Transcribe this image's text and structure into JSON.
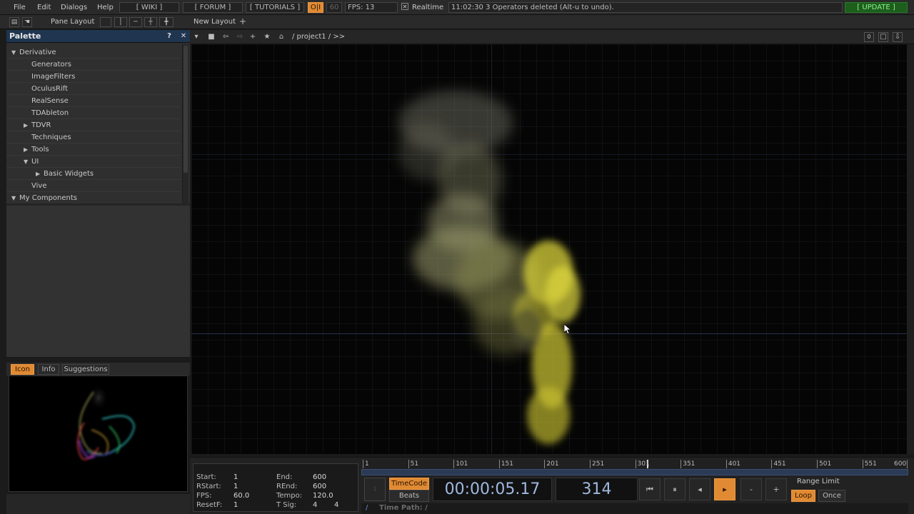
{
  "menu": {
    "items": [
      "File",
      "Edit",
      "Dialogs",
      "Help"
    ],
    "wiki": "[ WIKI ]",
    "forum": "[ FORUM ]",
    "tutorials": "[ TUTORIALS ]",
    "oi": "O|I",
    "fps_target": "60",
    "fps": "FPS:  13",
    "realtime": "Realtime",
    "status": "11:02:30 3 Operators deleted (Alt-u to undo).",
    "update": "[ UPDATE ]"
  },
  "layoutbar": {
    "pane_layout": "Pane Layout",
    "new_layout": "New Layout",
    "add": "+"
  },
  "palette": {
    "title": "Palette",
    "help": "?",
    "close": "✕",
    "items": [
      {
        "label": "Derivative",
        "indent": 0,
        "arrow": "down"
      },
      {
        "label": "Generators",
        "indent": 2,
        "arrow": ""
      },
      {
        "label": "ImageFilters",
        "indent": 2,
        "arrow": ""
      },
      {
        "label": "OculusRift",
        "indent": 2,
        "arrow": ""
      },
      {
        "label": "RealSense",
        "indent": 2,
        "arrow": ""
      },
      {
        "label": "TDAbleton",
        "indent": 2,
        "arrow": ""
      },
      {
        "label": "TDVR",
        "indent": 1,
        "arrow": "right"
      },
      {
        "label": "Techniques",
        "indent": 2,
        "arrow": ""
      },
      {
        "label": "Tools",
        "indent": 1,
        "arrow": "right"
      },
      {
        "label": "UI",
        "indent": 1,
        "arrow": "down"
      },
      {
        "label": "Basic Widgets",
        "indent": 3,
        "arrow": "right"
      },
      {
        "label": "Vive",
        "indent": 2,
        "arrow": ""
      },
      {
        "label": "My Components",
        "indent": 0,
        "arrow": "down"
      }
    ]
  },
  "viewer": {
    "tabs": [
      "Icon",
      "Info",
      "Suggestions"
    ],
    "active_tab": "Icon"
  },
  "network": {
    "path": "/ project1 / >>"
  },
  "time_settings": {
    "start_label": "Start:",
    "start": "1",
    "end_label": "End:",
    "end": "600",
    "rstart_label": "RStart:",
    "rstart": "1",
    "rend_label": "REnd:",
    "rend": "600",
    "fps_label": "FPS:",
    "fps": "60.0",
    "tempo_label": "Tempo:",
    "tempo": "120.0",
    "resetf_label": "ResetF:",
    "resetf": "1",
    "tsig_label": "T Sig:",
    "tsig_a": "4",
    "tsig_b": "4"
  },
  "ruler": {
    "ticks": [
      "1",
      "51",
      "101",
      "151",
      "201",
      "251",
      "301",
      "351",
      "401",
      "451",
      "501",
      "551",
      "600"
    ],
    "start": 1,
    "end": 600,
    "current_frame": 314
  },
  "transport": {
    "timecode_label": "TimeCode",
    "beats_label": "Beats",
    "timecode": "00:00:05.17",
    "frame": "314",
    "range_limit": "Range Limit",
    "loop": "Loop",
    "once": "Once",
    "minus": "-",
    "plus": "+"
  },
  "time_path": {
    "slash": "/",
    "label": "Time Path: /"
  },
  "colors": {
    "accent": "#e08a33",
    "palette_header": "#1f3550",
    "timecode_text": "#9fb8e0",
    "smoke_yellow": "#d8d23a"
  }
}
